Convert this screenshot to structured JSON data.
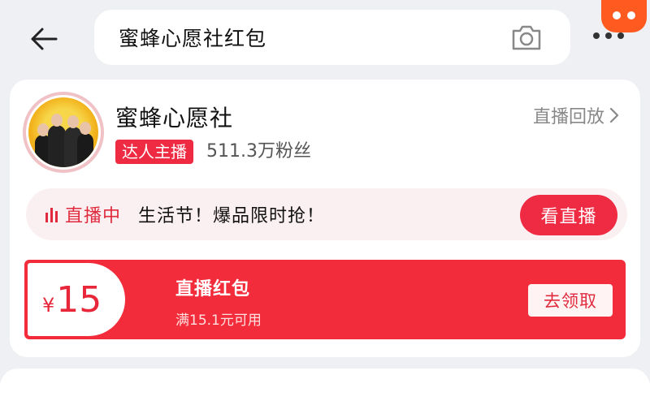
{
  "search": {
    "query": "蜜蜂心愿社红包",
    "back_icon": "arrow-left-icon",
    "camera_icon": "camera-icon"
  },
  "header": {
    "more_icon": "more-dots-icon",
    "mascot_icon": "mascot-icon",
    "mascot_color": "#ff5a1f"
  },
  "shop": {
    "name": "蜜蜂心愿社",
    "badge": "达人主播",
    "fans": "511.3万粉丝",
    "replay_label": "直播回放"
  },
  "live": {
    "status": "直播中",
    "promo": "生活节！爆品限时抢！",
    "watch_label": "看直播"
  },
  "coupon": {
    "currency": "¥",
    "amount": "15",
    "title": "直播红包",
    "condition": "满15.1元可用",
    "claim_label": "去领取"
  },
  "colors": {
    "accent": "#ee2b43",
    "coupon_bg": "#f22c3b",
    "page_bg": "#eef0f3"
  }
}
